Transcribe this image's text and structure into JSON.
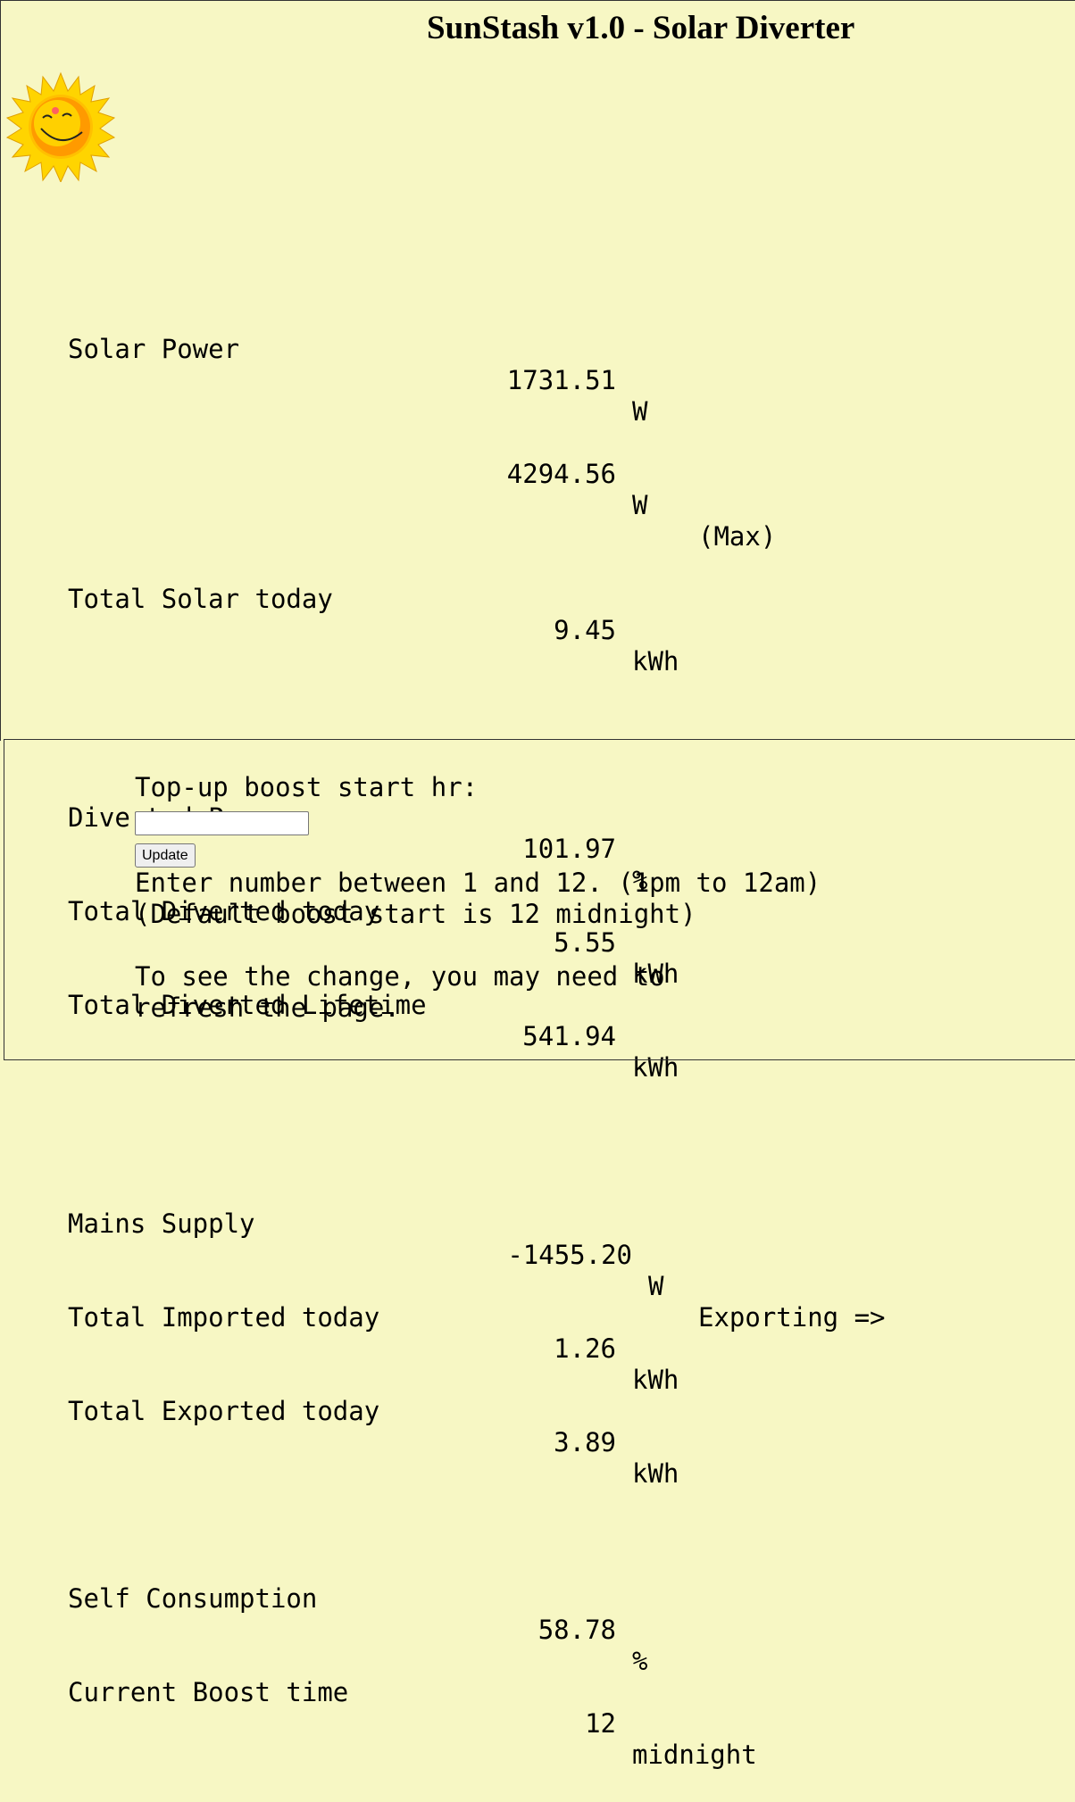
{
  "header": {
    "title": "SunStash v1.0 - Solar Diverter",
    "logo_icon": "smiling-sun-icon"
  },
  "stats": {
    "solar_power": {
      "label": "Solar Power",
      "value": "1731.51",
      "unit": "W"
    },
    "solar_max": {
      "label": "",
      "value": "4294.56",
      "unit": "W",
      "note": "(Max)"
    },
    "total_solar_today": {
      "label": "Total Solar today",
      "value": "9.45",
      "unit": "kWh"
    },
    "diverted_power": {
      "label": "Diverted Power",
      "value": "101.97",
      "unit": "%"
    },
    "total_diverted_today": {
      "label": "Total Diverted today",
      "value": "5.55",
      "unit": "kWh"
    },
    "total_diverted_lifetime": {
      "label": "Total Diverted Lifetime",
      "value": "541.94",
      "unit": "kWh"
    },
    "mains_supply": {
      "label": "Mains Supply",
      "value": "-1455.20",
      "unit": "W",
      "note": "Exporting =>"
    },
    "total_imported_today": {
      "label": "Total Imported today",
      "value": "1.26",
      "unit": "kWh"
    },
    "total_exported_today": {
      "label": "Total Exported today",
      "value": "3.89",
      "unit": "kWh"
    },
    "self_consumption": {
      "label": "Self Consumption",
      "value": "58.78",
      "unit": "%"
    },
    "current_boost_time": {
      "label": "Current Boost time",
      "value": "12",
      "unit": "midnight"
    }
  },
  "boost_form": {
    "label": "Top-up boost start hr:",
    "input_value": "",
    "button_label": "Update",
    "help_line1": "Enter number between 1 and 12. (1pm to 12am)",
    "help_line2": "(Default boost start is 12 midnight)",
    "help_line3": "",
    "help_line4": "To see the change, you may need to",
    "help_line5": "refresh the page."
  },
  "colors": {
    "background": "#f7f7c4",
    "sun_rays": "#ffd400",
    "sun_face": "#ff9900"
  }
}
